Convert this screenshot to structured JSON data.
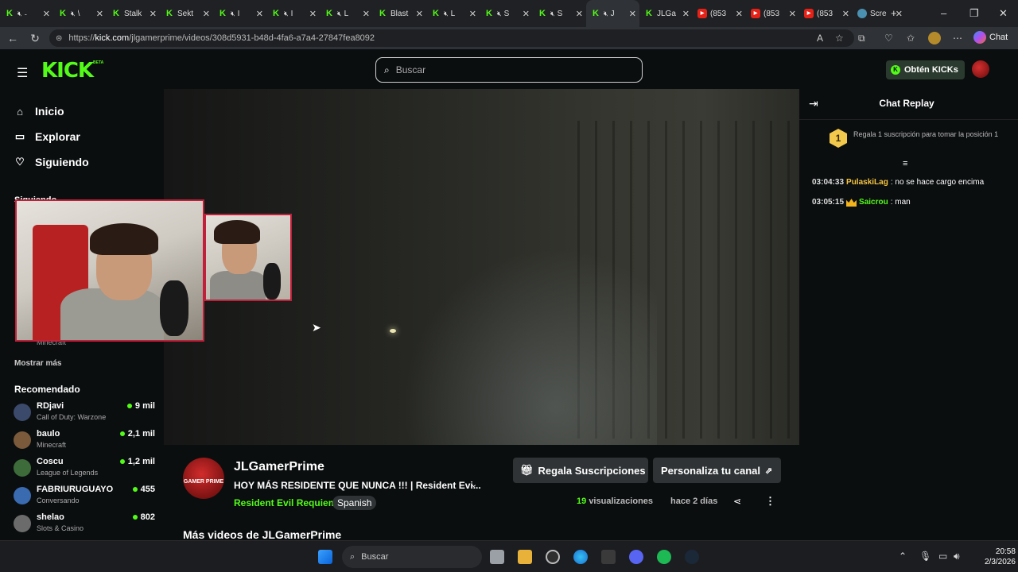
{
  "browser": {
    "tabs": [
      {
        "label": "̶",
        "kind": "k",
        "audio": true
      },
      {
        "label": "\\",
        "kind": "k",
        "audio": true
      },
      {
        "label": "Stalk",
        "kind": "k",
        "audio": false
      },
      {
        "label": "Sekt",
        "kind": "k",
        "audio": false
      },
      {
        "label": "I",
        "kind": "k",
        "audio": true
      },
      {
        "label": "I",
        "kind": "k",
        "audio": true
      },
      {
        "label": "L",
        "kind": "k",
        "audio": true
      },
      {
        "label": "Blast",
        "kind": "k",
        "audio": false
      },
      {
        "label": "L",
        "kind": "k",
        "audio": true
      },
      {
        "label": "S",
        "kind": "k",
        "audio": true
      },
      {
        "label": "S",
        "kind": "k",
        "audio": true
      },
      {
        "label": "J",
        "kind": "k",
        "audio": true,
        "active": true
      },
      {
        "label": "JLGa",
        "kind": "k",
        "audio": false
      },
      {
        "label": "(853",
        "kind": "yt",
        "audio": false
      },
      {
        "label": "(853",
        "kind": "yt",
        "audio": false
      },
      {
        "label": "(853",
        "kind": "yt",
        "audio": false
      },
      {
        "label": "Scre",
        "kind": "gl",
        "audio": false
      }
    ],
    "url_prefix": "https://",
    "url_domain": "kick.com",
    "url_path": "/jlgamerprime/videos/308d5931-b48d-4fa6-a7a4-27847fea8092",
    "chat_label": "Chat"
  },
  "kick": {
    "search_placeholder": "Buscar",
    "get_kicks": "Obtén KICKs",
    "logo": "KICK",
    "beta": "BETA"
  },
  "sidebar": {
    "nav": [
      {
        "label": "Inicio",
        "icon": "home-icon",
        "glyph": "⌂"
      },
      {
        "label": "Explorar",
        "icon": "browse-icon",
        "glyph": "▭"
      },
      {
        "label": "Siguiendo",
        "icon": "heart-icon",
        "glyph": "♡"
      }
    ],
    "following_title": "Siguiendo",
    "behind_text": "Minecraft",
    "show_more": "Mostrar más",
    "recommended_title": "Recomendado",
    "recommended": [
      {
        "name": "RDjavi",
        "game": "Call of Duty: Warzone",
        "viewers": "9 mil",
        "color": "#3b4a6b"
      },
      {
        "name": "baulo",
        "game": "Minecraft",
        "viewers": "2,1 mil",
        "color": "#7a5a3a"
      },
      {
        "name": "Coscu",
        "game": "League of Legends",
        "viewers": "1,2 mil",
        "color": "#3d6b3a"
      },
      {
        "name": "FABRIURUGUAYO",
        "game": "Conversando",
        "viewers": "455",
        "color": "#3a6ab0"
      },
      {
        "name": "shelao",
        "game": "Slots & Casino",
        "viewers": "802",
        "color": "#6b6b6b"
      }
    ]
  },
  "video": {
    "channel": "JLGamerPrime",
    "channel_logo_text": "GAMER PRIME",
    "title": "HOY MÁS RESIDENTE QUE NUNCA !!! | Resident Evi...",
    "category": "Resident Evil Requiem",
    "language": "Spanish",
    "gift_button": "Regala Suscripciones",
    "customize_button": "Personaliza tu canal",
    "views_count": "19",
    "views_label": "visualizaciones",
    "ago": "hace 2 días",
    "more_videos": "Más videos de JLGamerPrime"
  },
  "chat": {
    "title": "Chat Replay",
    "gift_rank": "1",
    "gift_text": "Regala 1 suscripción para tomar la posición 1",
    "messages": [
      {
        "time": "03:04:33",
        "user": "PulaskiLag",
        "text": ": no se hace cargo encima",
        "badge": false
      },
      {
        "time": "03:05:15",
        "user": "Saicrou",
        "text": ": man",
        "badge": true
      }
    ]
  },
  "taskbar": {
    "search": "Buscar",
    "time": "20:58",
    "date": "2/3/2026"
  }
}
